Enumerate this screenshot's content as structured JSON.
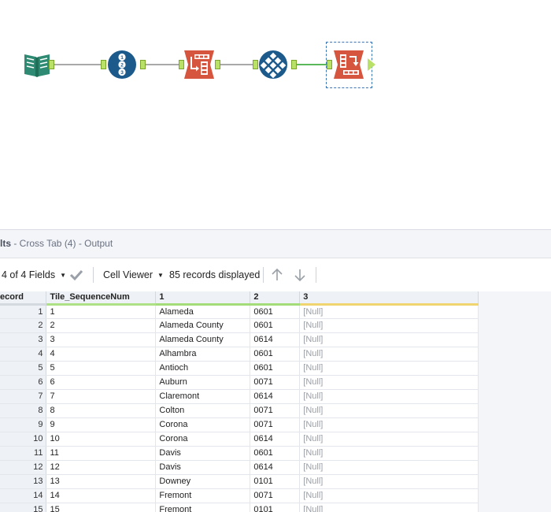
{
  "results_header": {
    "prefix": "lts",
    "title": " - Cross Tab (4) - Output"
  },
  "toolbar": {
    "fields_label": "4 of 4 Fields",
    "cell_viewer_label": "Cell Viewer",
    "records_label": "85 records displayed"
  },
  "grid": {
    "columns": [
      "ecord",
      "Tile_SequenceNum",
      "1",
      "2",
      "3"
    ],
    "rows": [
      {
        "record": "1",
        "seq": "1",
        "c1": "Alameda",
        "c2": "0601",
        "c3": "[Null]"
      },
      {
        "record": "2",
        "seq": "2",
        "c1": "Alameda County",
        "c2": "0601",
        "c3": "[Null]"
      },
      {
        "record": "3",
        "seq": "3",
        "c1": "Alameda County",
        "c2": "0614",
        "c3": "[Null]"
      },
      {
        "record": "4",
        "seq": "4",
        "c1": "Alhambra",
        "c2": "0601",
        "c3": "[Null]"
      },
      {
        "record": "5",
        "seq": "5",
        "c1": "Antioch",
        "c2": "0601",
        "c3": "[Null]"
      },
      {
        "record": "6",
        "seq": "6",
        "c1": "Auburn",
        "c2": "0071",
        "c3": "[Null]"
      },
      {
        "record": "7",
        "seq": "7",
        "c1": "Claremont",
        "c2": "0614",
        "c3": "[Null]"
      },
      {
        "record": "8",
        "seq": "8",
        "c1": "Colton",
        "c2": "0071",
        "c3": "[Null]"
      },
      {
        "record": "9",
        "seq": "9",
        "c1": "Corona",
        "c2": "0071",
        "c3": "[Null]"
      },
      {
        "record": "10",
        "seq": "10",
        "c1": "Corona",
        "c2": "0614",
        "c3": "[Null]"
      },
      {
        "record": "11",
        "seq": "11",
        "c1": "Davis",
        "c2": "0601",
        "c3": "[Null]"
      },
      {
        "record": "12",
        "seq": "12",
        "c1": "Davis",
        "c2": "0614",
        "c3": "[Null]"
      },
      {
        "record": "13",
        "seq": "13",
        "c1": "Downey",
        "c2": "0101",
        "c3": "[Null]"
      },
      {
        "record": "14",
        "seq": "14",
        "c1": "Fremont",
        "c2": "0071",
        "c3": "[Null]"
      },
      {
        "record": "15",
        "seq": "15",
        "c1": "Fremont",
        "c2": "0101",
        "c3": "[Null]"
      }
    ]
  },
  "workflow": {
    "tools": [
      {
        "name": "input-data-tool-icon",
        "color": "#2e8a72"
      },
      {
        "name": "record-id-tool-icon",
        "color": "#1d5a8c"
      },
      {
        "name": "transpose-tool-icon",
        "color": "#d5553f"
      },
      {
        "name": "tile-tool-icon",
        "color": "#1d5a8c"
      },
      {
        "name": "cross-tab-tool-icon",
        "color": "#d5553f"
      }
    ],
    "connection_color": "#a9a9a9",
    "selected_connection_color": "#5ab75a",
    "anchor_color": "#b9e067"
  }
}
